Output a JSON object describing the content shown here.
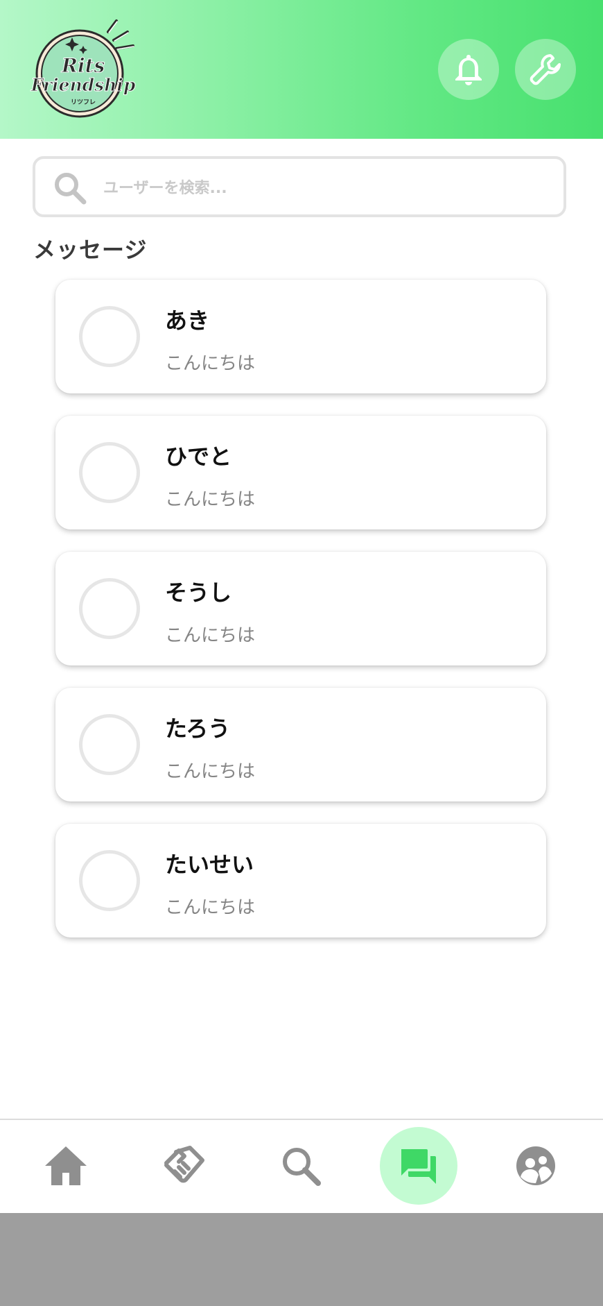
{
  "app": {
    "logo_line1": "Rits",
    "logo_line2": "Friendship",
    "logo_sub": "リツフレ"
  },
  "header": {
    "notification_icon": "bell-icon",
    "settings_icon": "wrench-icon"
  },
  "search": {
    "placeholder": "ユーザーを検索...",
    "value": ""
  },
  "section": {
    "title": "メッセージ"
  },
  "messages": [
    {
      "name": "あき",
      "preview": "こんにちは"
    },
    {
      "name": "ひでと",
      "preview": "こんにちは"
    },
    {
      "name": "そうし",
      "preview": "こんにちは"
    },
    {
      "name": "たろう",
      "preview": "こんにちは"
    },
    {
      "name": "たいせい",
      "preview": "こんにちは"
    }
  ],
  "nav": {
    "items": [
      "home-icon",
      "handshake-icon",
      "search-icon",
      "chat-icon",
      "group-icon"
    ],
    "active": "chat-icon"
  },
  "colors": {
    "accent": "#47e06e",
    "accent_light": "#c3fbd2",
    "nav_icon": "#8f8f8f"
  }
}
